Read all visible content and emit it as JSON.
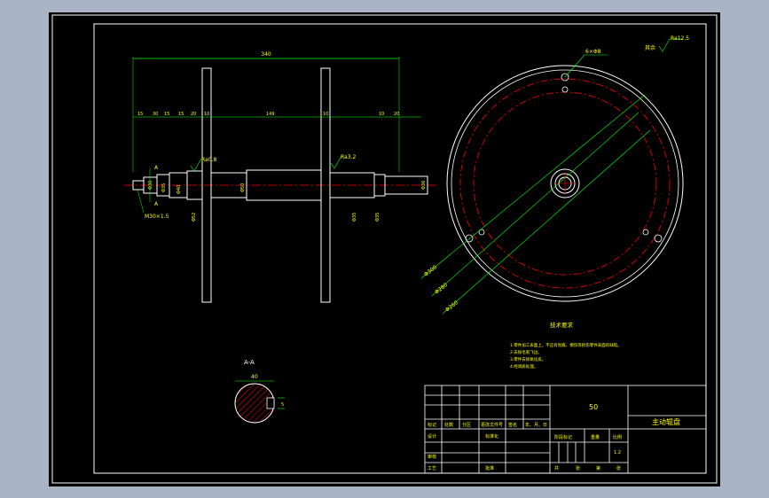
{
  "colors": {
    "background": "#000000",
    "frame": "#ffffff",
    "dimension": "#00ff00",
    "centerline": "#ff0000",
    "text": "#ffff00",
    "outer_bg": "#a9b5c4"
  },
  "shaft_view": {
    "overall_length": "340",
    "top_dims": [
      "15",
      "30",
      "15",
      "15",
      "20",
      "10",
      "149",
      "10",
      "10",
      "20"
    ],
    "diameters": [
      "Φ30",
      "Φ35",
      "Φ40",
      "Φ52",
      "Φ50",
      "Φ35",
      "Φ35",
      "Φ36"
    ],
    "section_marks": [
      "A",
      "A"
    ],
    "roughness": [
      "Ra0.8",
      "Ra3.2"
    ],
    "thread_label": "M30×1.5"
  },
  "disk_view": {
    "hole_callout": "6×Φ8",
    "diameters": [
      "Φ300",
      "Φ280",
      "Φ260"
    ]
  },
  "section_view": {
    "title": "A-A",
    "width_dim": "40",
    "key_dim": "5"
  },
  "roughness_note": {
    "prefix": "其余",
    "value": "Ra12.5"
  },
  "notes": {
    "title": "技术要求",
    "items": [
      "1.零件加工表面上，不应有划痕、擦伤等损伤零件表面的缺陷。",
      "2.去除毛刺飞边。",
      "3.零件去除氧化皮。",
      "4.经调质处理。"
    ]
  },
  "title_block": {
    "part_number": "50",
    "drawing_name": "主动辊盘",
    "scale": "1:2",
    "headers": [
      "标记",
      "处数",
      "分区",
      "更改文件号",
      "签名",
      "年、月、日"
    ],
    "labels": {
      "design": "设计",
      "standard": "标准化",
      "check": "审核",
      "process": "工艺",
      "approve": "批准",
      "stage_mark": "阶段标记",
      "weight": "重量",
      "scale_label": "比例",
      "sheet_total": "共",
      "sheet_unit": "张",
      "sheet_no": "第",
      "sheet_unit2": "张"
    }
  }
}
